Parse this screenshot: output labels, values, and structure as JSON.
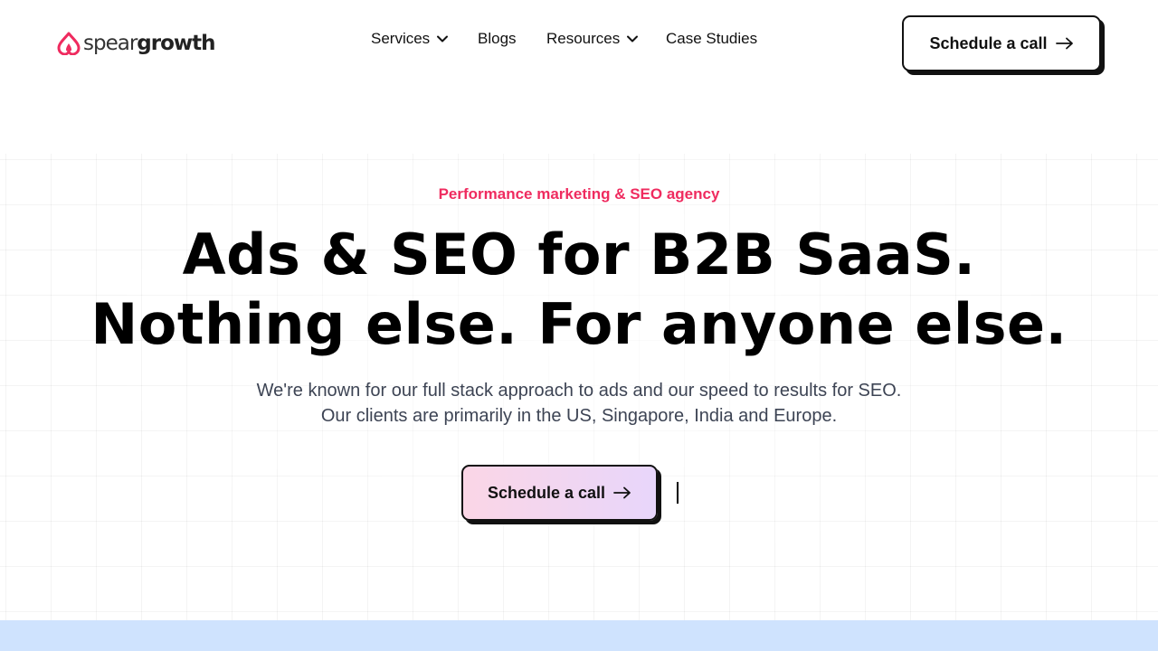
{
  "header": {
    "logo": {
      "part1": "spear",
      "part2": "growth",
      "icon": "spear-flame-icon",
      "color": "#ef2b5f"
    },
    "nav": [
      {
        "label": "Services",
        "has_dropdown": true
      },
      {
        "label": "Blogs",
        "has_dropdown": false
      },
      {
        "label": "Resources",
        "has_dropdown": true
      },
      {
        "label": "Case Studies",
        "has_dropdown": false
      }
    ],
    "cta_label": "Schedule a call"
  },
  "hero": {
    "eyebrow": "Performance marketing & SEO agency",
    "headline_line1": "Ads & SEO for B2B SaaS.",
    "headline_line2": "Nothing else. For anyone else.",
    "sub_line1": "We're known for our full stack approach to ads and our speed to results for SEO.",
    "sub_line2": "Our clients are primarily in the US, Singapore, India and Europe.",
    "cta_label": "Schedule a call"
  },
  "colors": {
    "accent": "#ef2b5f",
    "cta_gradient_start": "#fbd6e6",
    "cta_gradient_end": "#e8d6fb",
    "band": "#cfe3fe"
  }
}
